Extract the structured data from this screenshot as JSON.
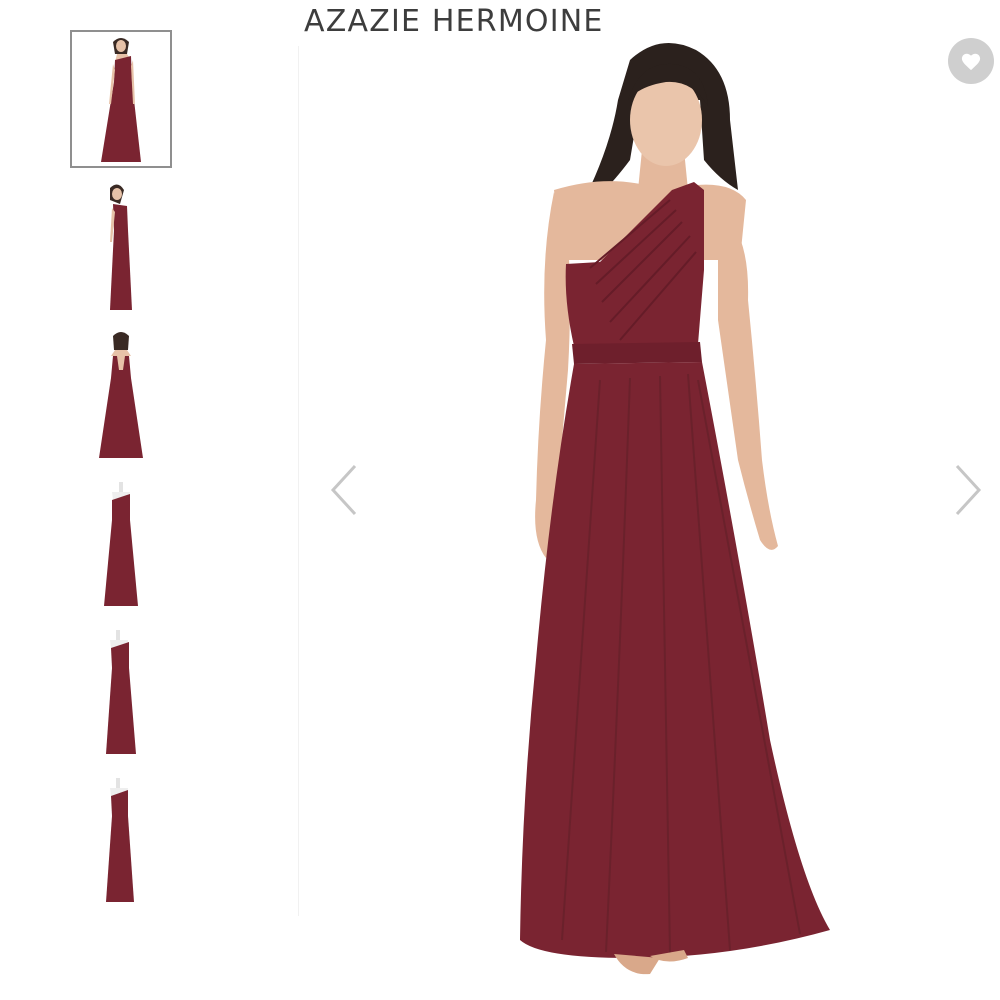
{
  "product": {
    "title": "AZAZIE HERMOINE",
    "dress_color": "#7a2431"
  },
  "gallery": {
    "thumbnails": [
      {
        "view": "model-front",
        "selected": true
      },
      {
        "view": "model-side",
        "selected": false
      },
      {
        "view": "model-back",
        "selected": false
      },
      {
        "view": "mannequin-front",
        "selected": false
      },
      {
        "view": "mannequin-three-quarter",
        "selected": false
      },
      {
        "view": "mannequin-side",
        "selected": false
      }
    ]
  },
  "icons": {
    "prev": "chevron-left-icon",
    "next": "chevron-right-icon",
    "wishlist": "heart-icon"
  }
}
